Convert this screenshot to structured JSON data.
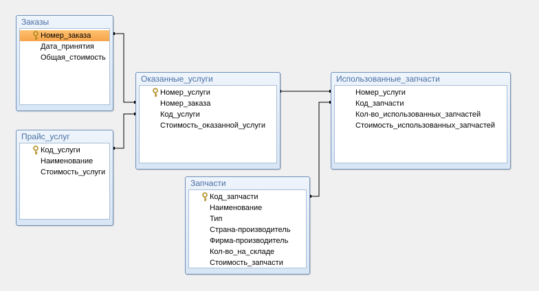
{
  "tables": {
    "zakazy": {
      "title": "Заказы",
      "fields": [
        "Номер_заказа",
        "Дата_принятия",
        "Общая_стоимость"
      ]
    },
    "prais": {
      "title": "Прайс_услуг",
      "fields": [
        "Код_услуги",
        "Наименование",
        "Стоимость_услуги"
      ]
    },
    "okazannye": {
      "title": "Оказанные_услуги",
      "fields": [
        "Номер_услуги",
        "Номер_заказа",
        "Код_услуги",
        "Стоимость_оказанной_услуги"
      ]
    },
    "ispolzovannye": {
      "title": "Использованные_запчасти",
      "fields": [
        "Номер_услуги",
        "Код_запчасти",
        "Кол-во_использованных_запчастей",
        "Стоимость_использованных_запчастей"
      ]
    },
    "zapchasti": {
      "title": "Запчасти",
      "fields": [
        "Код_запчасти",
        "Наименование",
        "Тип",
        "Страна-производитель",
        "Фирма-производитель",
        "Кол-во_на_складе",
        "Стоимость_запчасти"
      ]
    }
  },
  "key_icon": "key-icon",
  "colors": {
    "background": "#f0f0f0",
    "title_text": "#4a6fa5",
    "selected_field": "#f7b05a",
    "relationship_line": "#000000"
  }
}
